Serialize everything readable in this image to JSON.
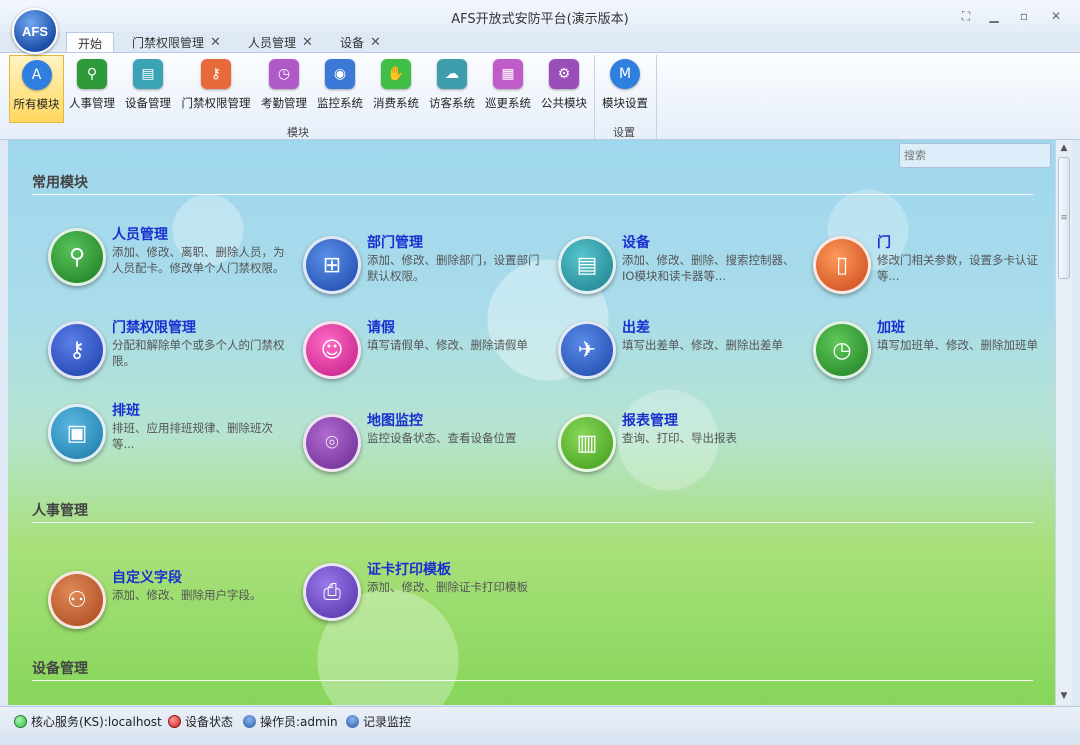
{
  "window": {
    "title": "AFS开放式安防平台(演示版本)",
    "logo_text": "AFS"
  },
  "tabs": [
    {
      "label": "开始",
      "closable": false
    },
    {
      "label": "门禁权限管理",
      "closable": true
    },
    {
      "label": "人员管理",
      "closable": true
    },
    {
      "label": "设备",
      "closable": true
    }
  ],
  "ribbon": {
    "items": [
      {
        "label": "所有模块",
        "icon": "all-modules-icon",
        "color": "#2f7fe0",
        "glyph": "A"
      },
      {
        "label": "人事管理",
        "icon": "person-icon",
        "color": "#2e9a3a",
        "glyph": "人"
      },
      {
        "label": "设备管理",
        "icon": "device-icon",
        "color": "#3aa3b5",
        "glyph": "设"
      },
      {
        "label": "门禁权限管理",
        "icon": "access-key-icon",
        "color": "#e86a3a",
        "glyph": "钥"
      },
      {
        "label": "考勤管理",
        "icon": "clock-icon",
        "color": "#b05ac8",
        "glyph": "钟"
      },
      {
        "label": "监控系统",
        "icon": "eye-icon",
        "color": "#3b78d8",
        "glyph": "眼"
      },
      {
        "label": "消费系统",
        "icon": "consume-icon",
        "color": "#3fbf46",
        "glyph": "消"
      },
      {
        "label": "访客系统",
        "icon": "visitor-icon",
        "color": "#3d9dab",
        "glyph": "访"
      },
      {
        "label": "巡更系统",
        "icon": "patrol-icon",
        "color": "#c05cc9",
        "glyph": "巡"
      },
      {
        "label": "公共模块",
        "icon": "gear-icon",
        "color": "#9a4fb8",
        "glyph": "⚙"
      },
      {
        "label": "模块设置",
        "icon": "module-settings-icon",
        "color": "#2f7fe0",
        "glyph": "M"
      }
    ],
    "group_modules": "模块",
    "group_settings": "设置"
  },
  "search": {
    "placeholder": "搜索"
  },
  "sections": {
    "common": "常用模块",
    "hr": "人事管理",
    "device": "设备管理"
  },
  "modules": [
    {
      "name": "人员管理",
      "desc": "添加、修改、离职、删除人员，为人员配卡。修改单个人门禁权限。",
      "icon": "person-gear-icon",
      "color": "#2e9a2e",
      "glyph": "人"
    },
    {
      "name": "部门管理",
      "desc": "添加、修改、删除部门，设置部门默认权限。",
      "icon": "org-chart-icon",
      "color": "#2a64c8",
      "glyph": "部"
    },
    {
      "name": "设备",
      "desc": "添加、修改、删除、搜索控制器、IO模块和读卡器等...",
      "icon": "device-icon",
      "color": "#2a9aa6",
      "glyph": "设"
    },
    {
      "name": "门",
      "desc": "修改门相关参数，设置多卡认证等...",
      "icon": "door-icon",
      "color": "#e2602a",
      "glyph": "门"
    },
    {
      "name": "门禁权限管理",
      "desc": "分配和解除单个或多个人的门禁权限。",
      "icon": "key-gear-icon",
      "color": "#2a55c8",
      "glyph": "钥"
    },
    {
      "name": "请假",
      "desc": "填写请假单、修改、删除请假单",
      "icon": "leave-icon",
      "color": "#e02a9a",
      "glyph": "假"
    },
    {
      "name": "出差",
      "desc": "填写出差单、修改、删除出差单",
      "icon": "trip-icon",
      "color": "#2a5fc8",
      "glyph": "差"
    },
    {
      "name": "加班",
      "desc": "填写加班单、修改、删除加班单",
      "icon": "overtime-icon",
      "color": "#2e9a2e",
      "glyph": "班"
    },
    {
      "name": "排班",
      "desc": "排班、应用排班规律、删除班次等...",
      "icon": "schedule-icon",
      "color": "#2a8ac0",
      "glyph": "排"
    },
    {
      "name": "地图监控",
      "desc": "监控设备状态、查看设备位置",
      "icon": "map-pin-icon",
      "color": "#8a3aa8",
      "glyph": "图"
    },
    {
      "name": "报表管理",
      "desc": "查询、打印、导出报表",
      "icon": "report-chart-icon",
      "color": "#58b42a",
      "glyph": "表"
    },
    {
      "name": "自定义字段",
      "desc": "添加、修改、删除用户字段。",
      "icon": "custom-field-icon",
      "color": "#c85a28",
      "glyph": "字"
    },
    {
      "name": "证卡打印模板",
      "desc": "添加、修改、删除证卡打印模板",
      "icon": "card-print-icon",
      "color": "#6a48c8",
      "glyph": "证"
    }
  ],
  "status": {
    "core": "核心服务(KS):localhost",
    "device": "设备状态",
    "operator": "操作员:admin",
    "record": "记录监控"
  }
}
